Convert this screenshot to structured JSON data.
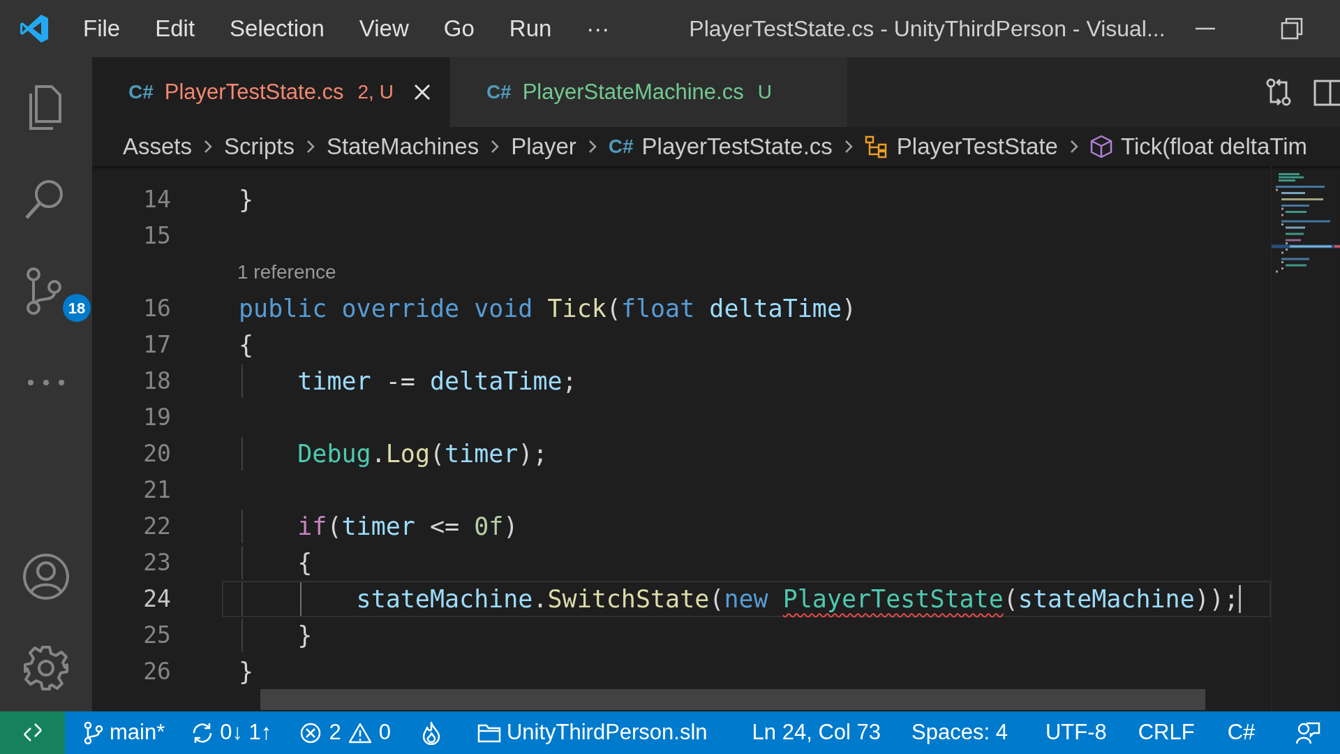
{
  "title_bar": {
    "menus": [
      "File",
      "Edit",
      "Selection",
      "View",
      "Go",
      "Run",
      "···"
    ],
    "title": "PlayerTestState.cs - UnityThirdPerson - Visual..."
  },
  "activity_bar": {
    "items": [
      {
        "kind": "files"
      },
      {
        "kind": "search"
      },
      {
        "kind": "source_control",
        "badge": "18"
      },
      {
        "kind": "more"
      },
      {
        "kind": "account"
      },
      {
        "kind": "settings"
      }
    ]
  },
  "tabs": [
    {
      "icon": "C#",
      "label": "PlayerTestState.cs",
      "badge": "2, U",
      "color": "#f48771",
      "selected": true
    },
    {
      "icon": "C#",
      "label": "PlayerStateMachine.cs",
      "badge": "U",
      "color": "#73c991",
      "selected": false
    }
  ],
  "breadcrumbs": [
    {
      "kind": "folder",
      "label": "Assets"
    },
    {
      "kind": "folder",
      "label": "Scripts"
    },
    {
      "kind": "folder",
      "label": "StateMachines"
    },
    {
      "kind": "folder",
      "label": "Player"
    },
    {
      "kind": "file",
      "icon": "C#",
      "label": "PlayerTestState.cs"
    },
    {
      "kind": "class",
      "label": "PlayerTestState"
    },
    {
      "kind": "method",
      "label": "Tick(float deltaTim"
    }
  ],
  "editor": {
    "lines": [
      {
        "number": "14",
        "current": false,
        "tokens": [
          {
            "text": "}",
            "kind": "plain"
          }
        ]
      },
      {
        "number": "15",
        "current": false
      },
      {
        "number": "16",
        "current": false,
        "codelens": "1 reference",
        "tokens": [
          {
            "text": "public override void ",
            "kind": "keyword"
          },
          {
            "text": "Tick",
            "kind": "method"
          },
          {
            "text": "(",
            "kind": "plain"
          },
          {
            "text": "float ",
            "kind": "keyword"
          },
          {
            "text": "deltaTime",
            "kind": "variable"
          },
          {
            "text": ")",
            "kind": "plain"
          }
        ]
      },
      {
        "number": "17",
        "current": false,
        "tokens": [
          {
            "text": "{",
            "kind": "plain"
          }
        ]
      },
      {
        "number": "18",
        "current": false,
        "tokens": [
          {
            "text": "    timer",
            "kind": "variable"
          },
          {
            "text": " -= ",
            "kind": "plain"
          },
          {
            "text": "deltaTime",
            "kind": "variable"
          },
          {
            "text": ";",
            "kind": "plain"
          }
        ]
      },
      {
        "number": "19",
        "current": false
      },
      {
        "number": "20",
        "current": false,
        "tokens": [
          {
            "text": "    Debug",
            "kind": "type"
          },
          {
            "text": ".",
            "kind": "plain"
          },
          {
            "text": "Log",
            "kind": "method"
          },
          {
            "text": "(",
            "kind": "plain"
          },
          {
            "text": "timer",
            "kind": "variable"
          },
          {
            "text": ");",
            "kind": "plain"
          }
        ]
      },
      {
        "number": "21",
        "current": false
      },
      {
        "number": "22",
        "current": false,
        "tokens": [
          {
            "text": "    if",
            "kind": "control"
          },
          {
            "text": "(",
            "kind": "plain"
          },
          {
            "text": "timer",
            "kind": "variable"
          },
          {
            "text": " <= ",
            "kind": "plain"
          },
          {
            "text": "0f",
            "kind": "number"
          },
          {
            "text": ")",
            "kind": "plain"
          }
        ]
      },
      {
        "number": "23",
        "current": false,
        "tokens": [
          {
            "text": "    {",
            "kind": "plain"
          }
        ]
      },
      {
        "number": "24",
        "current": true,
        "tokens": [
          {
            "text": "        stateMachine",
            "kind": "variable"
          },
          {
            "text": ".",
            "kind": "plain"
          },
          {
            "text": "SwitchState",
            "kind": "method"
          },
          {
            "text": "(",
            "kind": "plain"
          },
          {
            "text": "new ",
            "kind": "keyword"
          },
          {
            "text": "PlayerTestState",
            "kind": "type_error"
          },
          {
            "text": "(",
            "kind": "plain"
          },
          {
            "text": "stateMachine",
            "kind": "variable"
          },
          {
            "text": "));",
            "kind": "plain"
          }
        ]
      },
      {
        "number": "25",
        "current": false,
        "tokens": [
          {
            "text": "    }",
            "kind": "plain"
          }
        ]
      },
      {
        "number": "26",
        "current": false,
        "tokens": [
          {
            "text": "}",
            "kind": "plain"
          }
        ]
      }
    ]
  },
  "status_bar": {
    "branch": "main*",
    "sync": "0↓ 1↑",
    "errors": "2",
    "warnings": "0",
    "solution": "UnityThirdPerson.sln",
    "position": "Ln 24, Col 73",
    "indent": "Spaces: 4",
    "encoding": "UTF-8",
    "eol": "CRLF",
    "language": "C#"
  }
}
